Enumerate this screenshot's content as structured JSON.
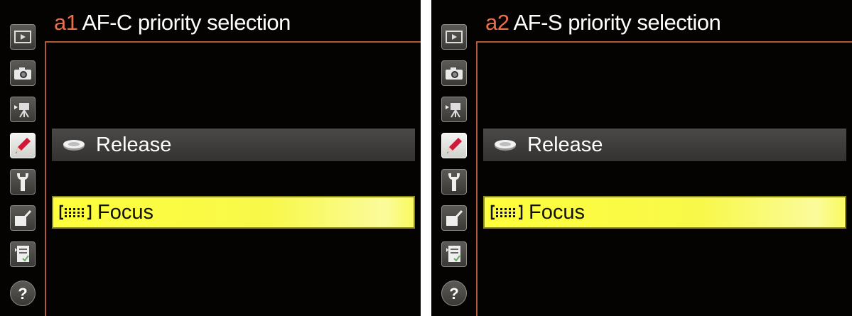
{
  "panels": [
    {
      "menu_code_letter": "a",
      "menu_code_digit": "1",
      "title": "AF-C priority selection",
      "options": [
        {
          "label": "Release",
          "icon": "shutter-release-icon",
          "selected": false
        },
        {
          "label": "Focus",
          "icon": "focus-area-icon",
          "selected": true
        }
      ]
    },
    {
      "menu_code_letter": "a",
      "menu_code_digit": "2",
      "title": "AF-S priority selection",
      "options": [
        {
          "label": "Release",
          "icon": "shutter-release-icon",
          "selected": false
        },
        {
          "label": "Focus",
          "icon": "focus-area-icon",
          "selected": true
        }
      ]
    }
  ],
  "tabs": [
    {
      "icon": "playback-icon",
      "active": false
    },
    {
      "icon": "camera-icon",
      "active": false
    },
    {
      "icon": "movie-icon",
      "active": false
    },
    {
      "icon": "pencil-icon",
      "active": true
    },
    {
      "icon": "wrench-icon",
      "active": false
    },
    {
      "icon": "retouch-icon",
      "active": false
    },
    {
      "icon": "my-menu-icon",
      "active": false
    },
    {
      "icon": "help-icon",
      "active": false
    }
  ],
  "colors": {
    "accent": "#e86f4c",
    "frame": "#b0573c",
    "highlight": "#fefe3c",
    "background": "#050302"
  }
}
